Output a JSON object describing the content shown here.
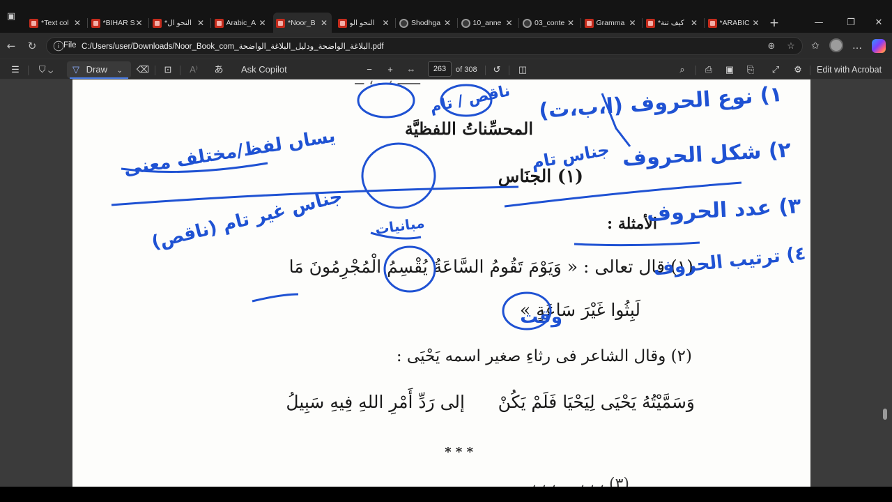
{
  "browser": {
    "tabs": [
      {
        "title": "*Text col",
        "icon": "pdf-icon"
      },
      {
        "title": "*BIHAR S",
        "icon": "pdf-icon"
      },
      {
        "title": "*النحو ال",
        "icon": "pdf-icon"
      },
      {
        "title": "Arabic_A",
        "icon": "pdf-icon"
      },
      {
        "title": "*Noor_B",
        "icon": "pdf-icon",
        "active": true
      },
      {
        "title": "النحو الو",
        "icon": "pdf-icon"
      },
      {
        "title": "Shodhga",
        "icon": "globe-icon"
      },
      {
        "title": "10_anne",
        "icon": "globe-icon"
      },
      {
        "title": "03_conte",
        "icon": "globe-icon"
      },
      {
        "title": "Gramma",
        "icon": "pdf-icon"
      },
      {
        "title": "*كيف تنة",
        "icon": "pdf-icon"
      },
      {
        "title": "*ARABIC",
        "icon": "pdf-icon"
      }
    ],
    "address": {
      "scheme": "File",
      "url": "C:/Users/user/Downloads/Noor_Book_com_البلاغة_الواضحة_ودليل_البلاغة_الواضحة.pdf"
    }
  },
  "pdf_toolbar": {
    "draw_label": "Draw",
    "ask_copilot_label": "Ask Copilot",
    "current_page": "263",
    "page_total": "of 308",
    "edit_acrobat_label": "Edit with Acrobat"
  },
  "document": {
    "heading": "المحسِّناتُ اللفظيَّة",
    "section_title": "(١) الجنَاس",
    "examples_label": "الأمثلة :",
    "example1_line1": "(١) قال تعالى : « وَيَوْمَ تَقُومُ السَّاعَةُ يُقْسِمُ الْمُجْرِمُونَ مَا",
    "example1_line2": "لَبِثُوا غَيْرَ سَاعَةٍ »",
    "example2_intro": "(٢) وقال الشاعر فى رثاءِ صغير اسمه يَحْيَى :",
    "verse_first": "وَسَمَّيْتُهُ يَحْيَى لِيَحْيَا فَلَمْ يَكُنْ",
    "verse_second": "إلى رَدِّ أَمْرِ اللهِ فِيهِ سَبِيلُ",
    "separator": "* * *"
  },
  "annotations": {
    "note_complete_incomplete": "ناقص / تام",
    "note_letter_type": "١) نوع الحروف (ا،ب،ت)",
    "note_letter_shape": "٢) شكل الحروف",
    "note_complete_jinas": "جناس تام",
    "note_same_word": "يساں لفظ/مختلف معنى",
    "note_letter_count": "٣) عدد الحروف",
    "note_letter_order": "٤) ترتيب الحروف",
    "note_incomplete_jinas": "جناس غير تام (ناقص)",
    "note_different": "مبانيات",
    "note_time": "وقت"
  }
}
